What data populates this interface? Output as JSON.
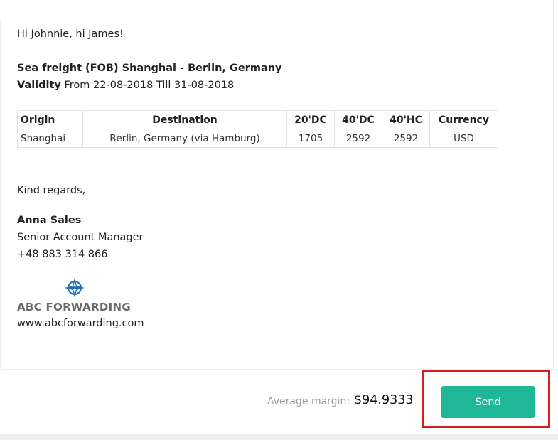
{
  "email": {
    "greeting": "Hi Johnnie, hi James!",
    "route_title": "Sea freight (FOB) Shanghai - Berlin, Germany",
    "validity_label": "Validity",
    "validity_text": "From 22-08-2018 Till 31-08-2018",
    "table": {
      "headers": [
        "Origin",
        "Destination",
        "20'DC",
        "40'DC",
        "40'HC",
        "Currency"
      ],
      "rows": [
        [
          "Shanghai",
          "Berlin, Germany (via Hamburg)",
          "1705",
          "2592",
          "2592",
          "USD"
        ]
      ]
    },
    "closing": "Kind regards,",
    "signature": {
      "name": "Anna Sales",
      "title": "Senior Account Manager",
      "phone": "+48 883 314 866",
      "company_logo_text": "ABC FORWARDING",
      "website": "www.abcforwarding.com"
    }
  },
  "footer": {
    "average_margin_label": "Average margin:",
    "average_margin_value": "$94.9333",
    "send_label": "Send"
  },
  "colors": {
    "send_button": "#1eb899",
    "highlight_border": "#d51f1f",
    "logo_blue": "#1f6fb5"
  }
}
